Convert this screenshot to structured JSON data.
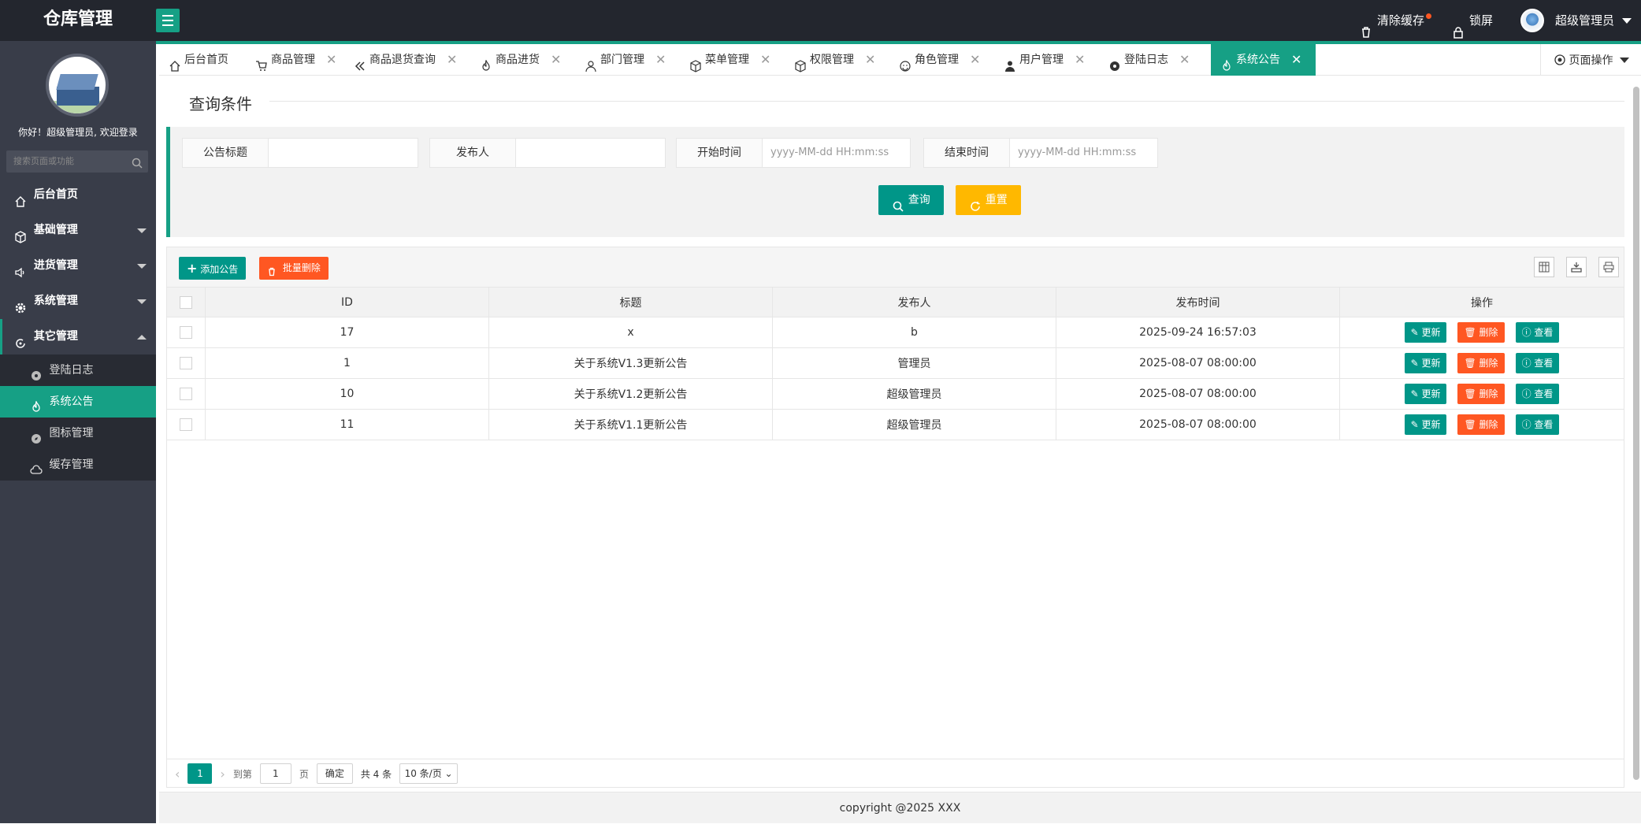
{
  "app": {
    "title": "仓库管理"
  },
  "header": {
    "clear_cache": "清除缓存",
    "lock": "锁屏",
    "user": "超级管理员"
  },
  "sidebar": {
    "welcome": "你好！超级管理员, 欢迎登录",
    "search_placeholder": "搜索页面或功能",
    "items": [
      {
        "label": "后台首页",
        "icon": "home-icon"
      },
      {
        "label": "基础管理",
        "icon": "cube-icon"
      },
      {
        "label": "进货管理",
        "icon": "volume-icon"
      },
      {
        "label": "系统管理",
        "icon": "gear-icon"
      },
      {
        "label": "其它管理",
        "icon": "circle-icon"
      }
    ],
    "sub_items": [
      {
        "label": "登陆日志",
        "icon": "eye-icon"
      },
      {
        "label": "系统公告",
        "icon": "fire-icon"
      },
      {
        "label": "图标管理",
        "icon": "compass-icon"
      },
      {
        "label": "缓存管理",
        "icon": "cloud-icon"
      }
    ]
  },
  "tabs": [
    {
      "label": "后台首页"
    },
    {
      "label": "商品管理"
    },
    {
      "label": "商品退货查询"
    },
    {
      "label": "商品进货"
    },
    {
      "label": "部门管理"
    },
    {
      "label": "菜单管理"
    },
    {
      "label": "权限管理"
    },
    {
      "label": "角色管理"
    },
    {
      "label": "用户管理"
    },
    {
      "label": "登陆日志"
    },
    {
      "label": "系统公告"
    }
  ],
  "page_op": "页面操作",
  "query": {
    "title": "查询条件",
    "fields": [
      {
        "label": "公告标题",
        "value": ""
      },
      {
        "label": "发布人",
        "value": ""
      },
      {
        "label": "开始时间",
        "placeholder": "yyyy-MM-dd HH:mm:ss"
      },
      {
        "label": "结束时间",
        "placeholder": "yyyy-MM-dd HH:mm:ss"
      }
    ],
    "search": "查询",
    "reset": "重置"
  },
  "toolbar": {
    "add": "添加公告",
    "batch_delete": "批量删除"
  },
  "table": {
    "columns": [
      "ID",
      "标题",
      "发布人",
      "发布时间",
      "操作"
    ],
    "rows": [
      {
        "id": "17",
        "title": "x",
        "publisher": "b",
        "time": "2025-09-24 16:57:03"
      },
      {
        "id": "1",
        "title": "关于系统V1.3更新公告",
        "publisher": "管理员",
        "time": "2025-08-07 08:00:00"
      },
      {
        "id": "10",
        "title": "关于系统V1.2更新公告",
        "publisher": "超级管理员",
        "time": "2025-08-07 08:00:00"
      },
      {
        "id": "11",
        "title": "关于系统V1.1更新公告",
        "publisher": "超级管理员",
        "time": "2025-08-07 08:00:00"
      }
    ],
    "actions": {
      "update": "更新",
      "delete": "删除",
      "view": "查看"
    }
  },
  "pager": {
    "current": "1",
    "goto": "到第",
    "goto_value": "1",
    "page": "页",
    "confirm": "确定",
    "total": "共 4 条",
    "size": "10 条/页"
  },
  "footer": "copyright @2025 XXX",
  "colors": {
    "accent": "#16a085",
    "primary": "#009688",
    "danger": "#ff5722",
    "warn": "#ffb800",
    "sidebar": "#393d49",
    "header": "#23262e"
  }
}
